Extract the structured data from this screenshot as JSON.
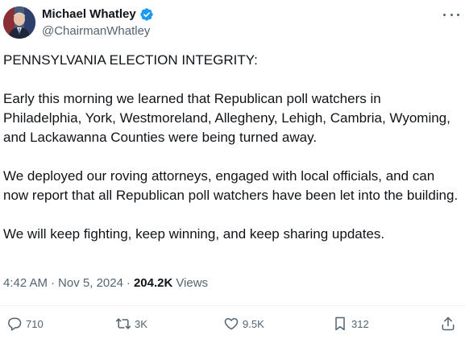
{
  "author": {
    "display_name": "Michael Whatley",
    "handle": "@ChairmanWhatley",
    "verified": true
  },
  "tweet": {
    "paragraphs": [
      "PENNSYLVANIA ELECTION INTEGRITY:",
      "Early this morning we learned that Republican poll watchers in Philadelphia, York, Westmoreland, Allegheny, Lehigh, Cambria, Wyoming, and Lackawanna Counties were being turned away.",
      "We deployed our roving attorneys, engaged with local officials, and can now report that all Republican poll watchers have been let into the building.",
      "We will keep fighting, keep winning, and keep sharing updates."
    ]
  },
  "meta": {
    "time": "4:42 AM",
    "separator": "·",
    "date": "Nov 5, 2024",
    "views_count": "204.2K",
    "views_label": "Views"
  },
  "actions": {
    "replies": "710",
    "reposts": "3K",
    "likes": "9.5K",
    "bookmarks": "312"
  },
  "icons": {
    "verified": "verified-badge-icon",
    "more": "more-icon",
    "reply": "reply-icon",
    "repost": "repost-icon",
    "like": "heart-icon",
    "bookmark": "bookmark-icon",
    "share": "share-icon"
  },
  "colors": {
    "verified": "#1d9bf0",
    "text": "#0f1419",
    "muted": "#536471"
  }
}
